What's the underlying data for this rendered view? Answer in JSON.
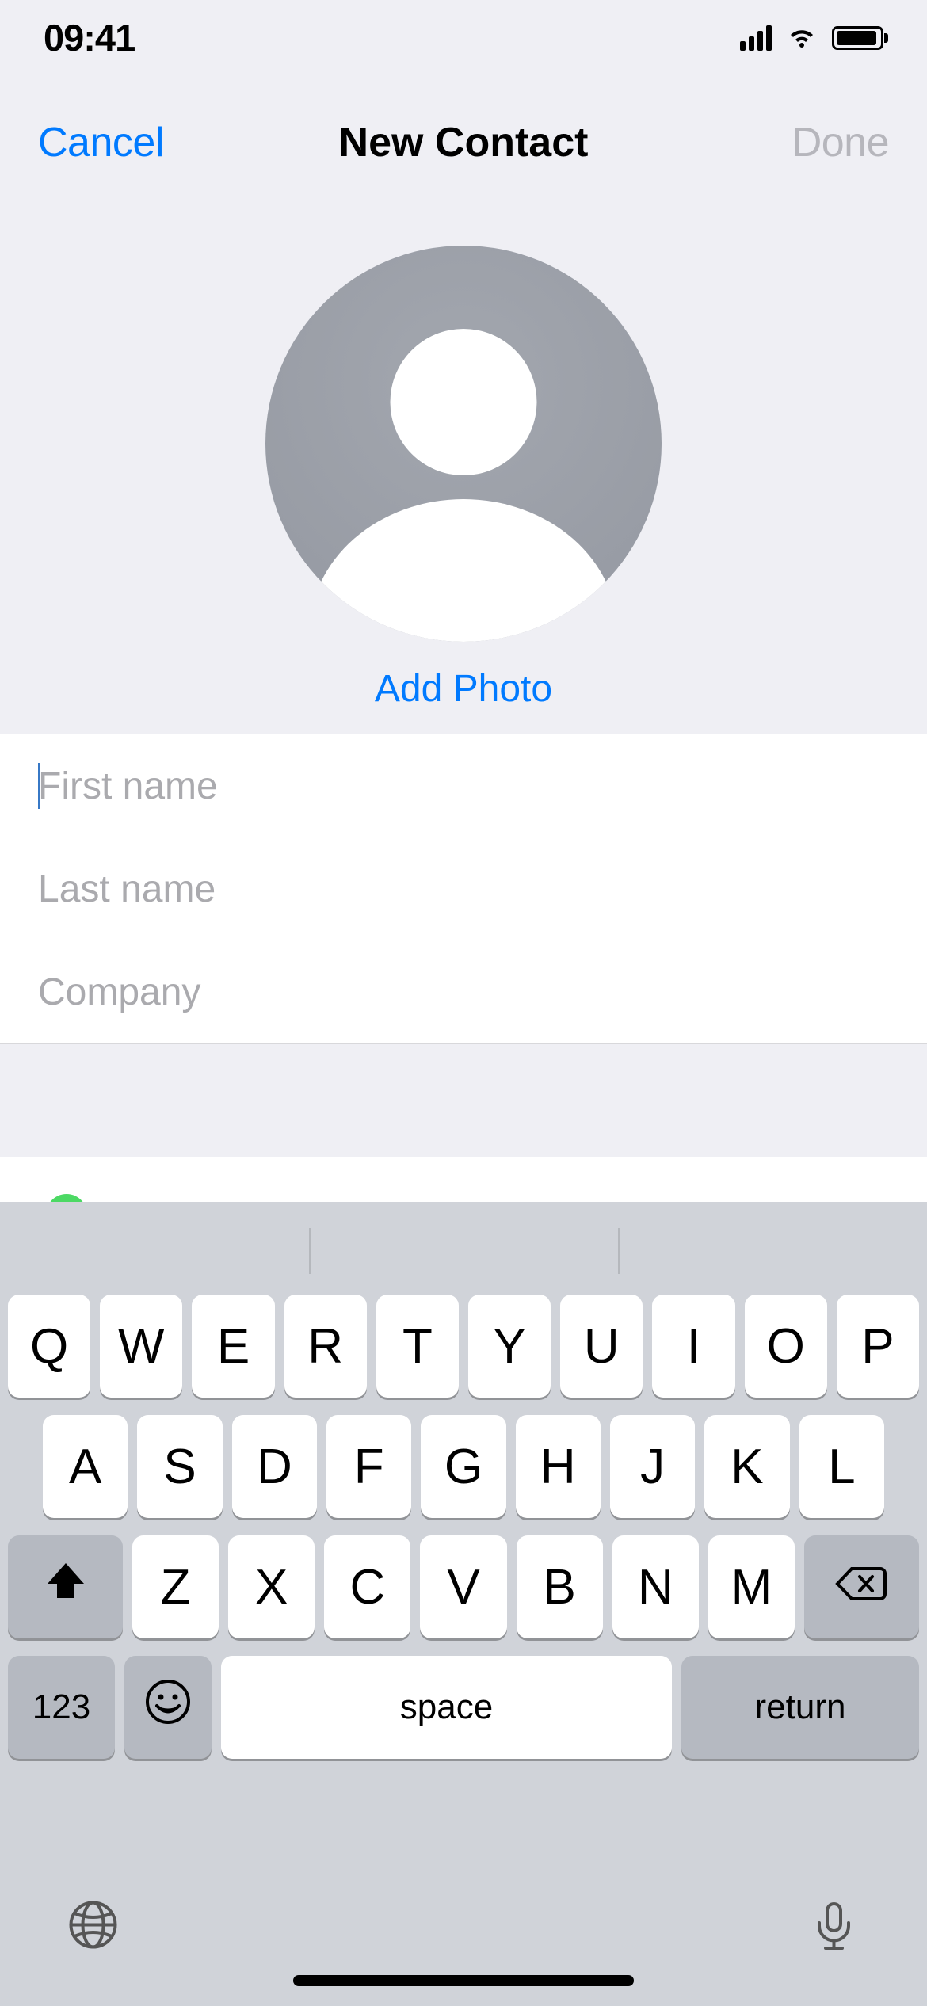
{
  "status": {
    "time": "09:41"
  },
  "nav": {
    "cancel": "Cancel",
    "title": "New Contact",
    "done": "Done"
  },
  "photo": {
    "add_label": "Add Photo"
  },
  "form": {
    "first_name_placeholder": "First name",
    "last_name_placeholder": "Last name",
    "company_placeholder": "Company",
    "first_name": "",
    "last_name": "",
    "company": ""
  },
  "keyboard": {
    "row1": [
      "Q",
      "W",
      "E",
      "R",
      "T",
      "Y",
      "U",
      "I",
      "O",
      "P"
    ],
    "row2": [
      "A",
      "S",
      "D",
      "F",
      "G",
      "H",
      "J",
      "K",
      "L"
    ],
    "row3": [
      "Z",
      "X",
      "C",
      "V",
      "B",
      "N",
      "M"
    ],
    "numeric_label": "123",
    "space_label": "space",
    "return_label": "return"
  }
}
